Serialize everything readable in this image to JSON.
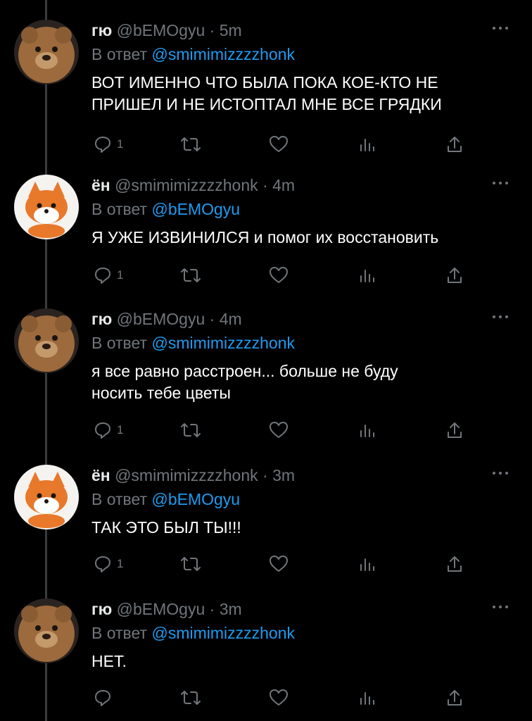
{
  "reply_prefix": "В ответ",
  "tweets": [
    {
      "name": "гю",
      "handle": "@bEMOgyu",
      "sep": "·",
      "time": "5m",
      "reply_to": "@smimimizzzzhonk",
      "lines": [
        "ВОТ ИМЕННО ЧТО БЫЛА ПОКА КОЕ-КТО НЕ",
        "ПРИШЕЛ И НЕ ИСТОПТАЛ МНЕ ВСЕ ГРЯДКИ"
      ],
      "reply_count": "1",
      "avatar": "bear-avatar"
    },
    {
      "name": "ён",
      "handle": "@smimimizzzzhonk",
      "sep": "·",
      "time": "4m",
      "reply_to": "@bEMOgyu",
      "lines": [
        "Я УЖЕ ИЗВИНИЛСЯ и помог их восстановить"
      ],
      "reply_count": "1",
      "avatar": "fox-avatar"
    },
    {
      "name": "гю",
      "handle": "@bEMOgyu",
      "sep": "·",
      "time": "4m",
      "reply_to": "@smimimizzzzhonk",
      "lines": [
        "я все равно расстроен... больше не буду",
        "носить тебе цветы"
      ],
      "reply_count": "1",
      "avatar": "bear-avatar"
    },
    {
      "name": "ён",
      "handle": "@smimimizzzzhonk",
      "sep": "·",
      "time": "3m",
      "reply_to": "@bEMOgyu",
      "lines": [
        "ТАК ЭТО БЫЛ ТЫ!!!"
      ],
      "reply_count": "1",
      "avatar": "fox-avatar"
    },
    {
      "name": "гю",
      "handle": "@bEMOgyu",
      "sep": "·",
      "time": "3m",
      "reply_to": "@smimimizzzzhonk",
      "lines": [
        "НЕТ."
      ],
      "reply_count": "",
      "avatar": "bear-avatar"
    }
  ],
  "colors": {
    "background": "#000000",
    "text": "#ffffff",
    "muted": "#71767b",
    "link": "#1d9bf0"
  }
}
